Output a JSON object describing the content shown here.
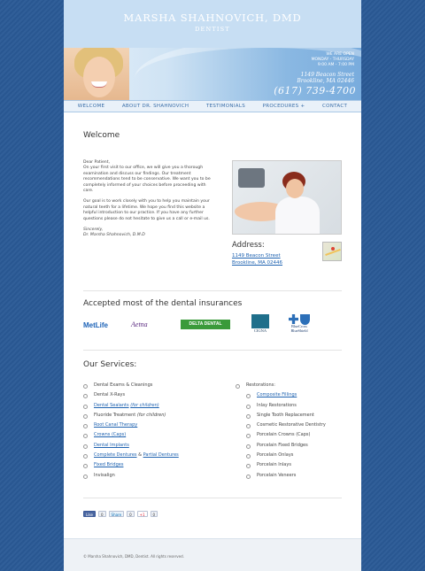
{
  "header": {
    "title": "MARSHA SHAHNOVICH, DMD",
    "subtitle": "DENTIST"
  },
  "banner": {
    "hours": [
      "WE ARE OPEN",
      "MONDAY - THURSDAY",
      "9:00 AM - 7:00 PM"
    ],
    "street": "1149 Beacon Street",
    "city": "Brookline, MA 02446",
    "phone": "(617) 739-4700"
  },
  "nav": {
    "items": [
      "WELCOME",
      "ABOUT DR. SHAHNOVICH",
      "TESTIMONIALS",
      "PROCEDURES +",
      "CONTACT"
    ]
  },
  "welcome": {
    "heading": "Welcome",
    "greeting": "Dear Patient,",
    "paragraph1": "On your first visit to our office, we will give you a thorough examination and discuss our findings. Our treatment recommendations tend to be conservative. We want you to be completely informed of your choices before proceeding with care.",
    "paragraph2": "Our goal is to work closely with you to help you maintain your natural teeth for a lifetime. We hope you find this website a helpful introduction to our practice. If you have any further questions please do not hesitate to give us a call or e-mail us.",
    "closing": "Sincerely,",
    "signature": "Dr. Marsha Shahnovich, D.M.D"
  },
  "address": {
    "heading": "Address:",
    "line1": "1149 Beacon Street",
    "line2": "Brookline, MA 02446"
  },
  "insurance": {
    "heading": "Accepted most of the dental insurances",
    "logos": {
      "metlife": "MetLife",
      "aetna": "Aetna",
      "delta": "DELTA DENTAL",
      "cigna": "CIGNA",
      "bcbs_line1": "BlueCross",
      "bcbs_line2": "BlueShield"
    }
  },
  "services": {
    "heading": "Our Services:",
    "left": {
      "exams": "Dental Exams & Cleanings",
      "xrays": "Dental X-Rays",
      "sealants": "Dental Sealants",
      "sealants_note": "(for children)",
      "fluoride": "Fluoride Treatment",
      "fluoride_note": "(for children)",
      "root_canal": "Root Canal Therapy",
      "crowns": "Crowns (Caps)",
      "implants": "Dental Implants",
      "complete_dentures": "Complete Dentures",
      "amp": " & ",
      "partial_dentures": "Partial Dentures",
      "bridges": "Fixed Bridges",
      "invisalign": "Invisalign"
    },
    "right": {
      "restorations": "Restorations:",
      "composite": "Composite Fillings",
      "inlay": "Inlay Restorations",
      "single_tooth": "Single Tooth Replacement",
      "cosmetic": "Cosmetic Restorative Dentistry",
      "porcelain_crowns": "Porcelain Crowns (Caps)",
      "porcelain_bridges": "Porcelain Fixed Bridges",
      "porcelain_onlays": "Porcelain Onlays",
      "porcelain_inlays": "Porcelain Inlays",
      "porcelain_veneers": "Porcelain Veneers"
    }
  },
  "social": {
    "like": "Like",
    "like_count": "0",
    "share": "Share",
    "share_count": "0",
    "gplus": "+1",
    "gplus_count": "0"
  },
  "footer": {
    "copyright": "© Marsha Shahnovich, DMD, Dentist. All rights reserved."
  }
}
